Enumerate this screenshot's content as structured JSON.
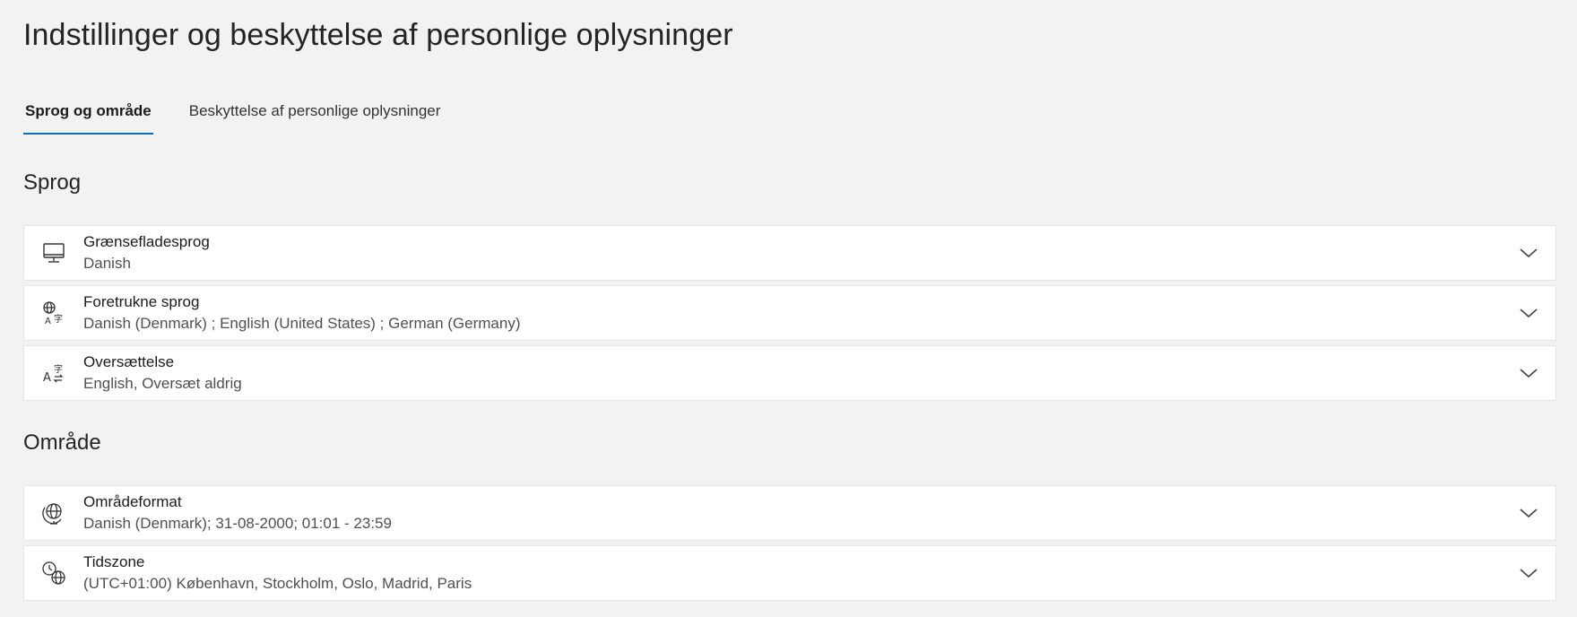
{
  "page": {
    "title": "Indstillinger og beskyttelse af personlige oplysninger"
  },
  "tabs": [
    {
      "label": "Sprog og område",
      "active": true
    },
    {
      "label": "Beskyttelse af personlige oplysninger",
      "active": false
    }
  ],
  "sections": {
    "language": {
      "title": "Sprog",
      "items": [
        {
          "icon": "monitor-icon",
          "label": "Grænsefladesprog",
          "value": "Danish"
        },
        {
          "icon": "language-globe-icon",
          "label": "Foretrukne sprog",
          "value": "Danish (Denmark) ; English (United States) ; German (Germany)"
        },
        {
          "icon": "translate-icon",
          "label": "Oversættelse",
          "value": "English, Oversæt aldrig"
        }
      ]
    },
    "region": {
      "title": "Område",
      "items": [
        {
          "icon": "globe-stand-icon",
          "label": "Områdeformat",
          "value": "Danish (Denmark); 31-08-2000; 01:01 - 23:59"
        },
        {
          "icon": "clock-globe-icon",
          "label": "Tidszone",
          "value": "(UTC+01:00) København, Stockholm, Oslo, Madrid, Paris"
        }
      ]
    }
  },
  "colors": {
    "accent": "#0f6cbd",
    "background": "#f2f2f2",
    "card": "#ffffff"
  }
}
